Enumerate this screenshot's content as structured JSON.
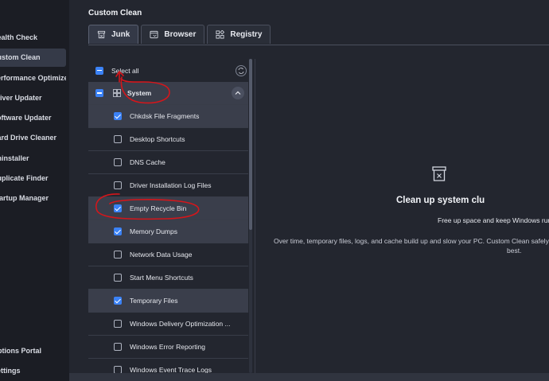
{
  "sidebar": {
    "items": [
      {
        "label": "Health Check"
      },
      {
        "label": "Custom Clean"
      },
      {
        "label": "Performance Optimizer"
      },
      {
        "label": "Driver Updater"
      },
      {
        "label": "Software Updater"
      },
      {
        "label": "Hard Drive Cleaner"
      },
      {
        "label": "Uninstaller"
      },
      {
        "label": "Duplicate Finder"
      },
      {
        "label": "Startup Manager"
      },
      {
        "label": "Options Portal"
      },
      {
        "label": "Settings"
      }
    ]
  },
  "header": {
    "title": "Custom Clean"
  },
  "tabs": [
    {
      "label": "Junk",
      "icon": "trash-icon"
    },
    {
      "label": "Browser",
      "icon": "browser-icon"
    },
    {
      "label": "Registry",
      "icon": "grid-icon"
    }
  ],
  "list": {
    "select_all": "Select all",
    "group": "System",
    "items": [
      {
        "label": "Chkdsk File Fragments"
      },
      {
        "label": "Desktop Shortcuts"
      },
      {
        "label": "DNS Cache"
      },
      {
        "label": "Driver Installation Log Files"
      },
      {
        "label": "Empty Recycle Bin"
      },
      {
        "label": "Memory Dumps"
      },
      {
        "label": "Network Data Usage"
      },
      {
        "label": "Start Menu Shortcuts"
      },
      {
        "label": "Temporary Files"
      },
      {
        "label": "Windows Delivery Optimization ..."
      },
      {
        "label": "Windows Error Reporting"
      },
      {
        "label": "Windows Event Trace Logs"
      }
    ]
  },
  "empty_state": {
    "title": "Clean up system clu",
    "subtitle": "Free up space and keep Windows run",
    "description": "Over time, temporary files, logs, and cache build up and slow your PC. Custom Clean safely re",
    "description_2": "best."
  },
  "colors": {
    "accent": "#3b82f6",
    "annotation": "#d4161b"
  }
}
